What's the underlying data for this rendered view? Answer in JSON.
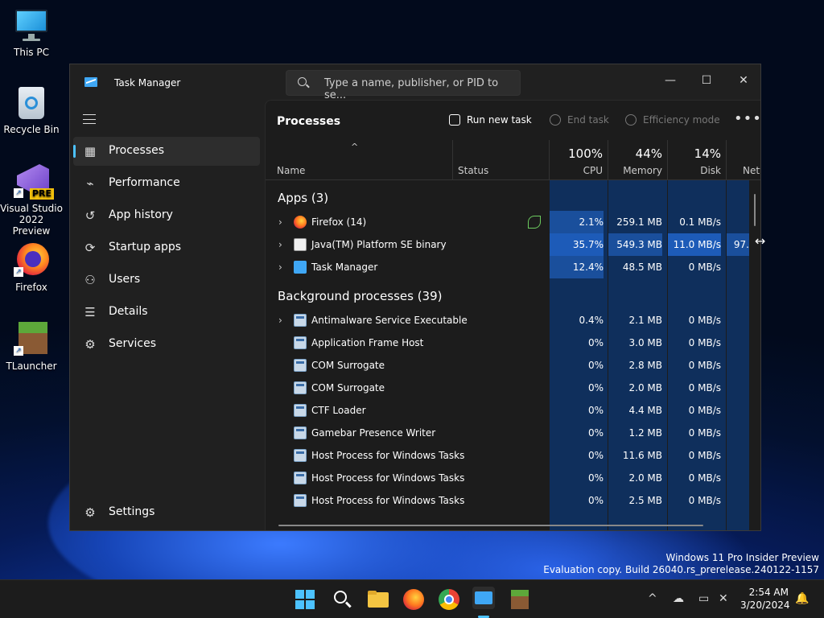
{
  "desktop": {
    "icons": [
      {
        "label": "This PC"
      },
      {
        "label": "Recycle Bin"
      },
      {
        "label": "Visual Studio 2022 Preview",
        "badge": "PRE"
      },
      {
        "label": "Firefox"
      },
      {
        "label": "TLauncher"
      }
    ]
  },
  "window": {
    "title": "Task Manager",
    "search_placeholder": "Type a name, publisher, or PID to se...",
    "controls": {
      "minimize": "—",
      "maximize": "☐",
      "close": "✕"
    }
  },
  "sidebar": {
    "items": [
      {
        "label": "Processes",
        "icon": "processes-icon"
      },
      {
        "label": "Performance",
        "icon": "performance-icon"
      },
      {
        "label": "App history",
        "icon": "app-history-icon"
      },
      {
        "label": "Startup apps",
        "icon": "startup-apps-icon"
      },
      {
        "label": "Users",
        "icon": "users-icon"
      },
      {
        "label": "Details",
        "icon": "details-icon"
      },
      {
        "label": "Services",
        "icon": "services-icon"
      }
    ],
    "settings_label": "Settings"
  },
  "toolbar": {
    "page_title": "Processes",
    "run_new_task": "Run new task",
    "end_task": "End task",
    "efficiency_mode": "Efficiency mode",
    "more": "•••"
  },
  "columns": {
    "name": "Name",
    "status": "Status",
    "cpu": {
      "pct": "100%",
      "label": "CPU"
    },
    "memory": {
      "pct": "44%",
      "label": "Memory"
    },
    "disk": {
      "pct": "14%",
      "label": "Disk"
    },
    "network": {
      "label": "Netw"
    }
  },
  "sections": {
    "apps": "Apps (3)",
    "background": "Background processes (39)"
  },
  "apps": [
    {
      "name": "Firefox (14)",
      "cpu": "2.1%",
      "memory": "259.1 MB",
      "disk": "0.1 MB/s",
      "net": "("
    },
    {
      "name": "Java(TM) Platform SE binary",
      "cpu": "35.7%",
      "memory": "549.3 MB",
      "disk": "11.0 MB/s",
      "net": "97."
    },
    {
      "name": "Task Manager",
      "cpu": "12.4%",
      "memory": "48.5 MB",
      "disk": "0 MB/s",
      "net": "("
    }
  ],
  "background": [
    {
      "name": "Antimalware Service Executable",
      "cpu": "0.4%",
      "memory": "2.1 MB",
      "disk": "0 MB/s",
      "net": "("
    },
    {
      "name": "Application Frame Host",
      "cpu": "0%",
      "memory": "3.0 MB",
      "disk": "0 MB/s",
      "net": "("
    },
    {
      "name": "COM Surrogate",
      "cpu": "0%",
      "memory": "2.8 MB",
      "disk": "0 MB/s",
      "net": "("
    },
    {
      "name": "COM Surrogate",
      "cpu": "0%",
      "memory": "2.0 MB",
      "disk": "0 MB/s",
      "net": "("
    },
    {
      "name": "CTF Loader",
      "cpu": "0%",
      "memory": "4.4 MB",
      "disk": "0 MB/s",
      "net": "("
    },
    {
      "name": "Gamebar Presence Writer",
      "cpu": "0%",
      "memory": "1.2 MB",
      "disk": "0 MB/s",
      "net": "("
    },
    {
      "name": "Host Process for Windows Tasks",
      "cpu": "0%",
      "memory": "11.6 MB",
      "disk": "0 MB/s",
      "net": "("
    },
    {
      "name": "Host Process for Windows Tasks",
      "cpu": "0%",
      "memory": "2.0 MB",
      "disk": "0 MB/s",
      "net": "("
    },
    {
      "name": "Host Process for Windows Tasks",
      "cpu": "0%",
      "memory": "2.5 MB",
      "disk": "0 MB/s",
      "net": "("
    }
  ],
  "watermark": {
    "line1": "Windows 11 Pro Insider Preview",
    "line2": "Evaluation copy. Build 26040.rs_prerelease.240122-1157"
  },
  "clock": {
    "time": "2:54 AM",
    "date": "3/20/2024"
  },
  "colors": {
    "accent": "#4cc2ff",
    "heat_low": "#0f3a6e",
    "heat_high": "#1a52a8"
  }
}
